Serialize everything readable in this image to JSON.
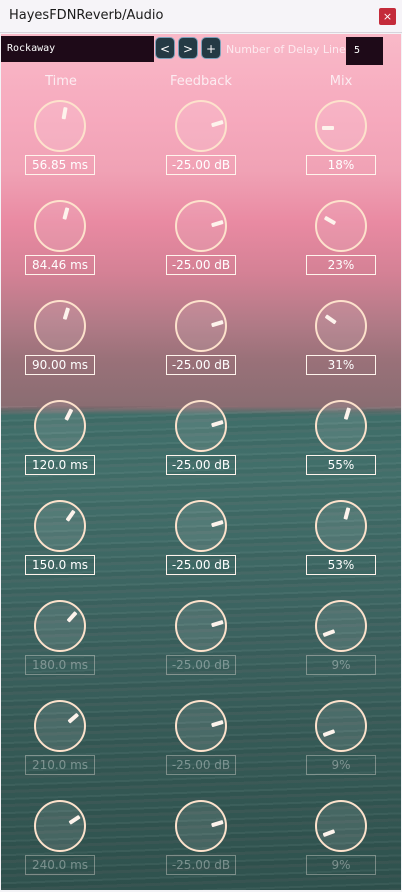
{
  "window": {
    "title": "HayesFDNReverb/Audio",
    "close_label": "×"
  },
  "preset": {
    "name": "Rockaway",
    "prev_label": "<",
    "next_label": ">",
    "add_label": "+"
  },
  "delay_lines": {
    "label": "Number of Delay Lines",
    "value": "5"
  },
  "columns": {
    "time": "Time",
    "feedback": "Feedback",
    "mix": "Mix"
  },
  "rows": [
    {
      "time": "56.85 ms",
      "feedback": "-25.00 dB",
      "mix": "18%",
      "active": true
    },
    {
      "time": "84.46 ms",
      "feedback": "-25.00 dB",
      "mix": "23%",
      "active": true
    },
    {
      "time": "90.00 ms",
      "feedback": "-25.00 dB",
      "mix": "31%",
      "active": true
    },
    {
      "time": "120.0 ms",
      "feedback": "-25.00 dB",
      "mix": "55%",
      "active": true
    },
    {
      "time": "150.0 ms",
      "feedback": "-25.00 dB",
      "mix": "53%",
      "active": true
    },
    {
      "time": "180.0 ms",
      "feedback": "-25.00 dB",
      "mix": "9%",
      "active": false
    },
    {
      "time": "210.0 ms",
      "feedback": "-25.00 dB",
      "mix": "9%",
      "active": false
    },
    {
      "time": "240.0 ms",
      "feedback": "-25.00 dB",
      "mix": "9%",
      "active": false
    }
  ],
  "knob_angles_deg": {
    "time": [
      10,
      15,
      17,
      27,
      35,
      42,
      49,
      57
    ],
    "feedback": [
      73,
      73,
      73,
      73,
      73,
      73,
      73,
      73
    ],
    "mix": [
      -90,
      -60,
      -55,
      17,
      15,
      -110,
      -110,
      -110
    ]
  },
  "colors": {
    "knob_ring": "#fde2cc",
    "preset_bg": "#1e0a18",
    "close_bg": "#c42b3a"
  }
}
